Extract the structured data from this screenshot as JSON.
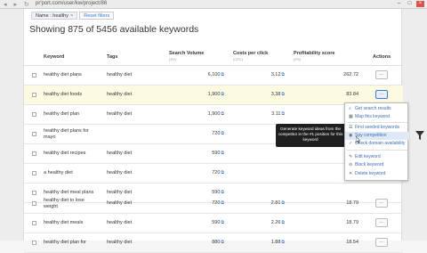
{
  "browser": {
    "url": "pr'port.com/user/kw/project/86",
    "nav_glyphs": "◂ ▸ ↻",
    "minimize": "–",
    "maximize": "□",
    "close": "×"
  },
  "filters": {
    "chip_label": "Name : healthy",
    "chip_remove": "×",
    "reset_label": "Reset filters"
  },
  "page": {
    "heading": "Showing 875 of 5456 available keywords"
  },
  "table": {
    "columns": {
      "keyword": "Keyword",
      "tags": "Tags",
      "volume": "Search Volume",
      "volume_sub": "(SV)",
      "cpc": "Costs per click",
      "cpc_sub": "(CPC)",
      "score": "Profitability score",
      "score_sub": "(PS)",
      "actions": "Actions"
    },
    "rows": [
      {
        "keyword": "healthy diet plans",
        "tag": "healthy diet",
        "volume": "6,100",
        "cpc": "3.12",
        "score": "262.72"
      },
      {
        "keyword": "healthy diet foods",
        "tag": "healthy diet",
        "volume": "1,900",
        "cpc": "3.38",
        "score": "83.84"
      },
      {
        "keyword": "healthy diet plan",
        "tag": "healthy diet",
        "volume": "1,900",
        "cpc": "3.11",
        "score": ""
      },
      {
        "keyword": "healthy diet plans for mayo",
        "tag": "",
        "volume": "720",
        "cpc": "",
        "score": ""
      },
      {
        "keyword": "healthy diet recipes",
        "tag": "healthy diet",
        "volume": "590",
        "cpc": "",
        "score": ""
      },
      {
        "keyword": "a healthy diet",
        "tag": "healthy diet",
        "volume": "720",
        "cpc": "",
        "score": ""
      },
      {
        "keyword": "healthy diet meal plans",
        "tag": "healthy diet",
        "volume": "590",
        "cpc": "",
        "score": ""
      },
      {
        "keyword": "healthy diet to lose weight",
        "tag": "healthy diet",
        "volume": "720",
        "cpc": "2.81",
        "score": "18.79"
      },
      {
        "keyword": "healthy diet meals",
        "tag": "healthy diet",
        "volume": "590",
        "cpc": "2.26",
        "score": "18.79"
      },
      {
        "keyword": "healthy diet plan for",
        "tag": "healthy diet",
        "volume": "880",
        "cpc": "1.88",
        "score": "18.54"
      }
    ],
    "ext_glyph": "⧉",
    "actions_glyph": "..."
  },
  "action_menu": {
    "items": [
      {
        "icon": "search",
        "glyph": "⌕",
        "label": "Get search results"
      },
      {
        "icon": "map",
        "glyph": "▦",
        "label": "Map this keyword"
      },
      {
        "icon": "list",
        "glyph": "☰",
        "label": "Find seeded keywords"
      },
      {
        "icon": "spy",
        "glyph": "◉",
        "label": "Spy competition"
      },
      {
        "icon": "check",
        "glyph": "✓",
        "label": "Check domain availability"
      },
      {
        "icon": "edit",
        "glyph": "✎",
        "label": "Edit keyword"
      },
      {
        "icon": "block",
        "glyph": "⊘",
        "label": "Block keyword"
      },
      {
        "icon": "delete",
        "glyph": "✕",
        "label": "Delete keyword"
      }
    ]
  },
  "tooltip": {
    "text": "Generate keyword ideas from the competitor in the #1 position for this keyword"
  }
}
